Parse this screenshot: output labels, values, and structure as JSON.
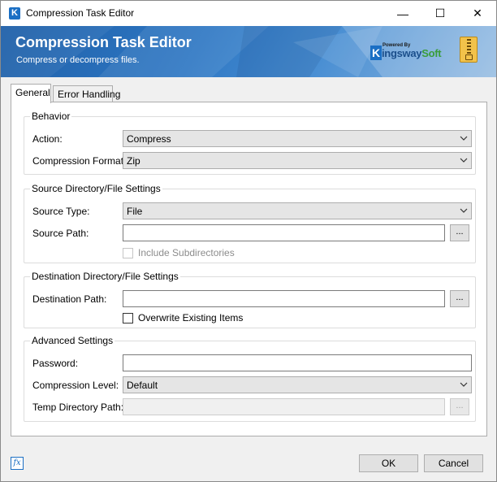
{
  "window": {
    "title": "Compression Task Editor",
    "app_icon_letter": "K",
    "minimize_glyph": "—",
    "maximize_glyph": "☐",
    "close_glyph": "✕"
  },
  "banner": {
    "title": "Compression Task Editor",
    "subtitle": "Compress or decompress files.",
    "logo_powered": "Powered By",
    "logo_k": "K",
    "logo_name": "ingsway",
    "logo_soft": "Soft",
    "icon": "zip-file-icon"
  },
  "tabs": [
    {
      "label": "General",
      "active": true
    },
    {
      "label": "Error Handling",
      "active": false
    }
  ],
  "behavior": {
    "title": "Behavior",
    "action_label": "Action:",
    "action_value": "Compress",
    "format_label": "Compression Format:",
    "format_value": "Zip"
  },
  "source": {
    "title": "Source Directory/File Settings",
    "type_label": "Source Type:",
    "type_value": "File",
    "path_label": "Source Path:",
    "path_value": "",
    "browse": "...",
    "include_sub_label": "Include Subdirectories",
    "include_sub_checked": false
  },
  "destination": {
    "title": "Destination Directory/File Settings",
    "path_label": "Destination Path:",
    "path_value": "",
    "browse": "...",
    "overwrite_label": "Overwrite Existing Items",
    "overwrite_checked": false
  },
  "advanced": {
    "title": "Advanced Settings",
    "password_label": "Password:",
    "password_value": "",
    "level_label": "Compression Level:",
    "level_value": "Default",
    "temp_label": "Temp Directory Path:",
    "temp_value": "",
    "browse": "..."
  },
  "footer": {
    "fx_label": "fx",
    "ok": "OK",
    "cancel": "Cancel"
  },
  "colors": {
    "banner_dark": "#1e5fa8",
    "banner_light": "#8fb8e0",
    "brand_blue": "#1b6fc4",
    "brand_green": "#3a9d3a"
  }
}
